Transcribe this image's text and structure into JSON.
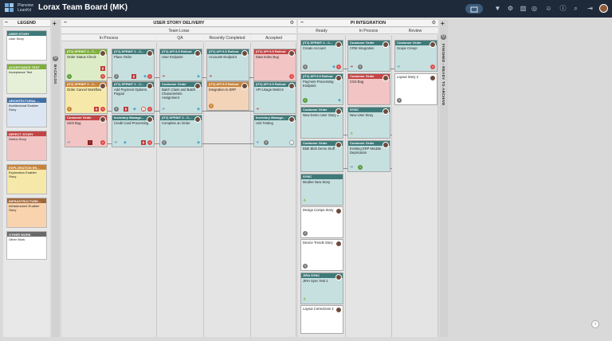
{
  "app": {
    "brand_line1": "Planview",
    "brand_line2": "LeanKit",
    "board_title": "Lorax Team Board (MK)"
  },
  "colors": {
    "topbar": "#1e2a3a",
    "accent": "#3b5b7a"
  },
  "toolbar_icons": [
    "filter-icon",
    "settings-icon",
    "chart-icon",
    "globe-icon",
    "user-add-icon",
    "info-icon",
    "search-icon",
    "exit-icon"
  ],
  "legend": {
    "title": "LEGEND",
    "items": [
      {
        "header": "USER STORY",
        "label": "User Story"
      },
      {
        "header": "ACCEPTANCE TEST",
        "label": "Acceptance Test"
      },
      {
        "header": "ARCHITECTURAL ...",
        "label": "Architectural Enabler Story"
      },
      {
        "header": "DEFECT STORY",
        "label": "Defect Story"
      },
      {
        "header": "EXPLORATION EN...",
        "label": "Exploration Enabler Story"
      },
      {
        "header": "INFRASTRUCTURE...",
        "label": "Infrastructure Enabler Story"
      },
      {
        "header": "OTHER WORK",
        "label": "Other Work"
      }
    ]
  },
  "backlog": {
    "label": "BACKLOG",
    "count": "0"
  },
  "finished": {
    "label": "FINISHED - READY TO ARCHIVE",
    "count": "0"
  },
  "usd": {
    "title": "USER STORY DELIVERY",
    "team": "Team Lorax",
    "columns": [
      "In Process",
      "QA",
      "Recently Completed",
      "Accepted"
    ]
  },
  "pi": {
    "title": "PI INTEGRATION",
    "columns": [
      "Ready",
      "In Process",
      "Review"
    ]
  },
  "cards": {
    "c1": {
      "h": "(IT2) SPRINT 2 - C...",
      "b": "Order Status Check",
      "badge": "1"
    },
    "c2": {
      "h": "(IT2) SPRINT 2 - C...",
      "b": "Order Cancel Workflow",
      "badge": "1"
    },
    "c3": {
      "h": "Customer Order",
      "b": "SSO Bug"
    },
    "c4": {
      "h": "(IT2) SPRINT 2 - C...",
      "b": "Place Order",
      "badge": "0"
    },
    "c5": {
      "h": "(IT2) SPRINT 2 - C...",
      "b": "Add Payment Options: Paypal",
      "badge": "0"
    },
    "c6": {
      "h": "Inventory Manage...",
      "b": "Credit Card Processing"
    },
    "c7": {
      "h": "(IT2) API 5.5 Rollout",
      "b": "User Endpoint"
    },
    "c8": {
      "h": "Customer Order",
      "b": "Batch Class and Batch Characteristic Assignment"
    },
    "c9": {
      "h": "(IT2) SPRINT 2 - C...",
      "b": "Complete an Order",
      "badge": "0"
    },
    "c10": {
      "h": "(IT2) API 5.5 Rollout",
      "b": "Accounts Endpoint"
    },
    "c11": {
      "h": "(IT2) API 5.5 Rollout",
      "b": "Integration to ERP",
      "badge": "0"
    },
    "c12": {
      "h": "(IT2) API 5.5 Rollout",
      "b": "Data Index Bug"
    },
    "c13": {
      "h": "(IT2) API 5.5 Rollout",
      "b": "API Usage Metrics"
    },
    "c14": {
      "h": "Inventory Manage...",
      "b": "Unit Testing",
      "badge": "0"
    },
    "r1": {
      "h": "(IT2) SPRINT 2 - C...",
      "b": "Create Account",
      "badge": "0"
    },
    "r2": {
      "h": "(IT2) API 5.5 Rollout",
      "b": "Payment Processing Endpoint",
      "badge": "1"
    },
    "r3": {
      "h": "Customer Order",
      "b": "New Demo User Story 2"
    },
    "r4": {
      "h": "Customer Order",
      "b": "Blah Blah Demo Stuff"
    },
    "r5": {
      "h": "SYNC",
      "b": "Mcafee New Story"
    },
    "r6": {
      "h": "",
      "b": "Design Comps Story",
      "badge": "0"
    },
    "r7": {
      "h": "",
      "b": "Device Trends Story",
      "badge": "0"
    },
    "r8": {
      "h": "JIRA SYNC",
      "b": "JIRA Sync Test 1"
    },
    "r9": {
      "h": "",
      "b": "Layout Corrections 3"
    },
    "p1": {
      "h": "Customer Order",
      "b": "CRM Integration",
      "badge": "0"
    },
    "p2": {
      "h": "Customer Order",
      "b": "CSS Bug"
    },
    "p3": {
      "h": "SYNC",
      "b": "New User Story"
    },
    "p4": {
      "h": "Customer Order",
      "b": "Existing ERP Module Deprication",
      "badge": "1"
    },
    "v1": {
      "h": "Customer Order",
      "b": "Scope Creep!"
    },
    "v2": {
      "h": "",
      "b": "Layout Story 2",
      "badge": "0"
    }
  }
}
